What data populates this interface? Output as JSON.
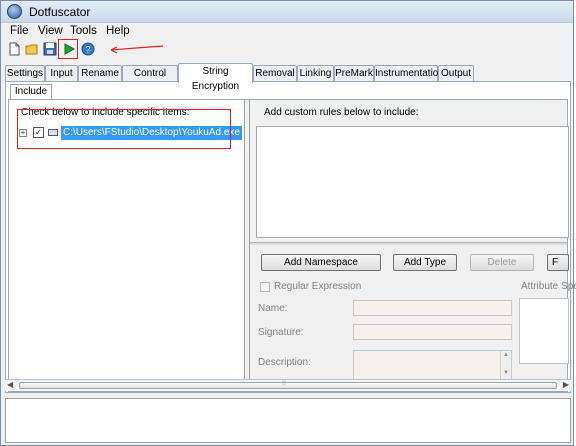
{
  "window": {
    "title": "Dotfuscator"
  },
  "menu": [
    {
      "label": "File"
    },
    {
      "label": "View"
    },
    {
      "label": "Tools"
    },
    {
      "label": "Help"
    }
  ],
  "toolbar": {
    "buttons": [
      "new-file",
      "open-folder",
      "save",
      "build-run",
      "help"
    ]
  },
  "tabs": [
    {
      "label": "Settings"
    },
    {
      "label": "Input"
    },
    {
      "label": "Rename"
    },
    {
      "label": "Control Flow"
    },
    {
      "label": "String Encryption",
      "active": true
    },
    {
      "label": "Removal"
    },
    {
      "label": "Linking"
    },
    {
      "label": "PreMark"
    },
    {
      "label": "Instrumentation"
    },
    {
      "label": "Output"
    }
  ],
  "subtab": {
    "label": "Include"
  },
  "left": {
    "header": "Check below to include specific items:",
    "tree": [
      {
        "label": "C:\\Users\\FStudio\\Desktop\\YoukuAd.exe",
        "checked": true,
        "expandable": true,
        "selected": true
      }
    ]
  },
  "right": {
    "header": "Add custom rules below to include:",
    "buttons": {
      "add_namespace": "Add Namespace",
      "add_type": "Add Type",
      "delete": "Delete",
      "partial": "F"
    },
    "regex_label": "Regular Expression",
    "regex_checked": false,
    "attribute_label": "Attribute Spe",
    "fields": {
      "name": "Name:",
      "signature": "Signature:",
      "description": "Description:"
    }
  },
  "annotation": {
    "color": "#e02020"
  }
}
